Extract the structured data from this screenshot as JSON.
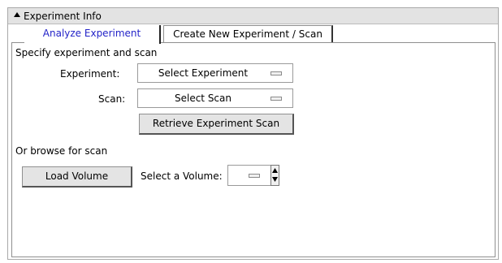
{
  "panel": {
    "title": "Experiment Info",
    "collapse_icon": "triangle-up-icon"
  },
  "tabs": [
    {
      "label": "Analyze Experiment",
      "active": true
    },
    {
      "label": "Create New Experiment / Scan",
      "active": false
    }
  ],
  "analyze": {
    "section_label": "Specify experiment and scan",
    "experiment_label": "Experiment:",
    "experiment_value": "Select Experiment",
    "scan_label": "Scan:",
    "scan_value": "Select Scan",
    "retrieve_button": "Retrieve Experiment Scan",
    "browse_label": "Or browse for scan",
    "load_button": "Load Volume",
    "volume_label": "Select a Volume:",
    "volume_value": ""
  },
  "colors": {
    "active_tab_text": "#2323c8",
    "header_bg": "#e3e3e3",
    "button_bg": "#e4e4e4"
  }
}
